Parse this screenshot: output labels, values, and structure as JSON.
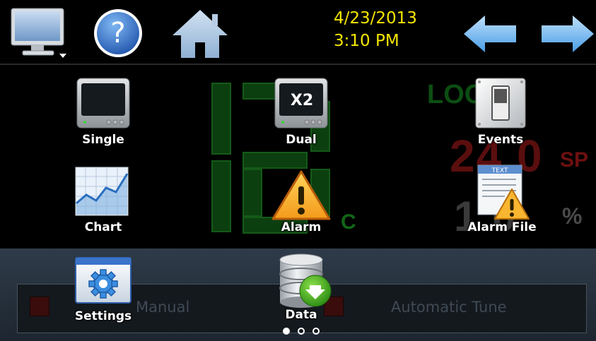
{
  "header": {
    "date": "4/23/2013",
    "time": "3:10 PM",
    "monitor_icon": "monitor-icon",
    "help_icon": "help-icon",
    "home_icon": "home-icon",
    "back_icon": "arrow-left-icon",
    "forward_icon": "arrow-right-icon"
  },
  "background": {
    "loop_label": "LOO",
    "sp_value": "24 0",
    "sp_unit": "SP",
    "pct_value": "1  0",
    "pct_unit": "%",
    "temp_unit": "C",
    "manual_label": "Manual",
    "autotune_label": "Automatic Tune"
  },
  "menu": {
    "items": [
      {
        "label": "Single",
        "icon": "single-view-icon"
      },
      {
        "label": "Dual",
        "icon": "dual-view-icon",
        "badge": "X2"
      },
      {
        "label": "Events",
        "icon": "events-switch-icon"
      },
      {
        "label": "Chart",
        "icon": "chart-icon"
      },
      {
        "label": "Alarm",
        "icon": "alarm-icon"
      },
      {
        "label": "Alarm File",
        "icon": "alarm-file-icon",
        "doc_title": "TEXT"
      },
      {
        "label": "Settings",
        "icon": "settings-icon"
      },
      {
        "label": "Data",
        "icon": "data-icon"
      }
    ]
  },
  "pager": {
    "pages": 3,
    "current": 1
  },
  "colors": {
    "date_text": "#f4e600",
    "arrow": "#6fb8f2",
    "ghost_green": "#0f4a12",
    "ghost_red": "#5a0e0e"
  }
}
